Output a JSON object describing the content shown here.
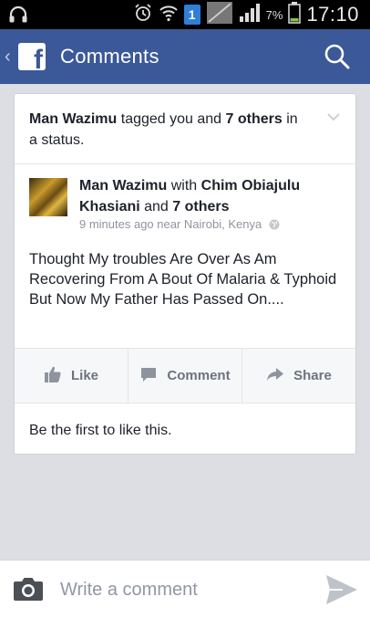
{
  "status_bar": {
    "sim_number": "1",
    "battery_pct": "7%",
    "time": "17:10"
  },
  "header": {
    "title": "Comments"
  },
  "notification": {
    "actor": "Man Wazimu",
    "text_mid": " tagged you and ",
    "others": "7 others",
    "text_end": " in a status."
  },
  "post": {
    "author": "Man Wazimu",
    "with_word": " with ",
    "tagged": "Chim Obiajulu Khasiani",
    "and_word": " and ",
    "others": "7 others",
    "time": "9 minutes ago near Nairobi, Kenya",
    "body": "Thought My troubles Are Over As Am Recovering From A Bout Of Malaria & Typhoid But Now My Father Has Passed On...."
  },
  "actions": {
    "like": "Like",
    "comment": "Comment",
    "share": "Share"
  },
  "likes_text": "Be the first to like this.",
  "composer": {
    "placeholder": "Write a comment"
  },
  "colors": {
    "brand": "#3b5998",
    "card_bg": "#ffffff",
    "page_bg": "#dcdee3"
  }
}
